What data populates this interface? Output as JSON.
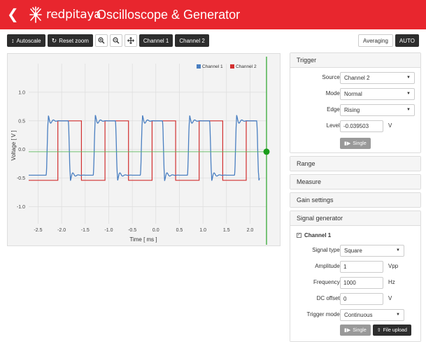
{
  "header": {
    "logo_text": "redpitaya",
    "title": "Oscilloscope & Generator",
    "bg_color": "#e8262e"
  },
  "toolbar": {
    "autoscale_label": "Autoscale",
    "reset_zoom_label": "Reset zoom",
    "zoom_in_icon": "zoom-in-icon",
    "zoom_out_icon": "zoom-out-icon",
    "pan_icon": "pan-icon",
    "channel1_label": "Channel 1",
    "channel2_label": "Channel 2",
    "averaging_label": "Averaging",
    "auto_label": "AUTO"
  },
  "chart_data": {
    "type": "line",
    "xlabel": "Time [ ms ]",
    "ylabel": "Voltage [ V ]",
    "xlim": [
      -2.7,
      2.35
    ],
    "ylim": [
      -1.3,
      1.5
    ],
    "xticks": [
      -2.5,
      -2.0,
      -1.5,
      -1.0,
      -0.5,
      0.0,
      0.5,
      1.0,
      1.5,
      2.0
    ],
    "xtick_labels": [
      "-2.5",
      "-2.0",
      "-1.5",
      "-1.0",
      "-0.5",
      "0.0",
      "0.5",
      "1.0",
      "1.5",
      "2.0"
    ],
    "yticks": [
      1.0,
      0.5,
      0.0,
      -0.5,
      -1.0
    ],
    "ytick_labels": [
      "1.0",
      "0.5",
      "0.0",
      "-0.5",
      "-1.0"
    ],
    "grid": true,
    "legend_position": "top-right",
    "trigger_level": -0.0395,
    "trigger_time": 2.35,
    "series": [
      {
        "name": "Channel 1",
        "color": "#4a7fc1",
        "kind": "ringing-square",
        "high": 0.5,
        "low": -0.45,
        "overshoot": 0.6,
        "undershoot": -0.55,
        "edges": [
          -2.33,
          -1.86,
          -1.33,
          -0.86,
          -0.33,
          0.14,
          0.67,
          1.14,
          1.67,
          2.14
        ],
        "x_start": -2.7,
        "x_end": 2.2
      },
      {
        "name": "Channel 2",
        "color": "#d22f2f",
        "kind": "square",
        "high": 0.5,
        "low": -0.54,
        "edges": [
          -2.08,
          -1.58,
          -1.08,
          -0.58,
          -0.08,
          0.42,
          0.92,
          1.42,
          1.92
        ],
        "first_state": "low",
        "x_start": -2.7,
        "x_end": 2.1
      }
    ]
  },
  "panels": {
    "trigger": {
      "title": "Trigger",
      "source_label": "Source:",
      "source_value": "Channel 2",
      "mode_label": "Mode:",
      "mode_value": "Normal",
      "edge_label": "Edge:",
      "edge_value": "Rising",
      "level_label": "Level:",
      "level_value": "-0.039503",
      "level_unit": "V",
      "single_label": "Single"
    },
    "range_title": "Range",
    "measure_title": "Measure",
    "gain_title": "Gain settings",
    "generator": {
      "title": "Signal generator",
      "channel_label": "Channel 1",
      "signal_type_label": "Signal type:",
      "signal_type_value": "Square",
      "amplitude_label": "Amplitude:",
      "amplitude_value": "1",
      "amplitude_unit": "Vpp",
      "frequency_label": "Frequency:",
      "frequency_value": "1000",
      "frequency_unit": "Hz",
      "dc_offset_label": "DC offset:",
      "dc_offset_value": "0",
      "dc_offset_unit": "V",
      "trigger_mode_label": "Trigger mode:",
      "trigger_mode_value": "Continuous",
      "single_label": "Single",
      "file_upload_label": "File upload"
    }
  }
}
